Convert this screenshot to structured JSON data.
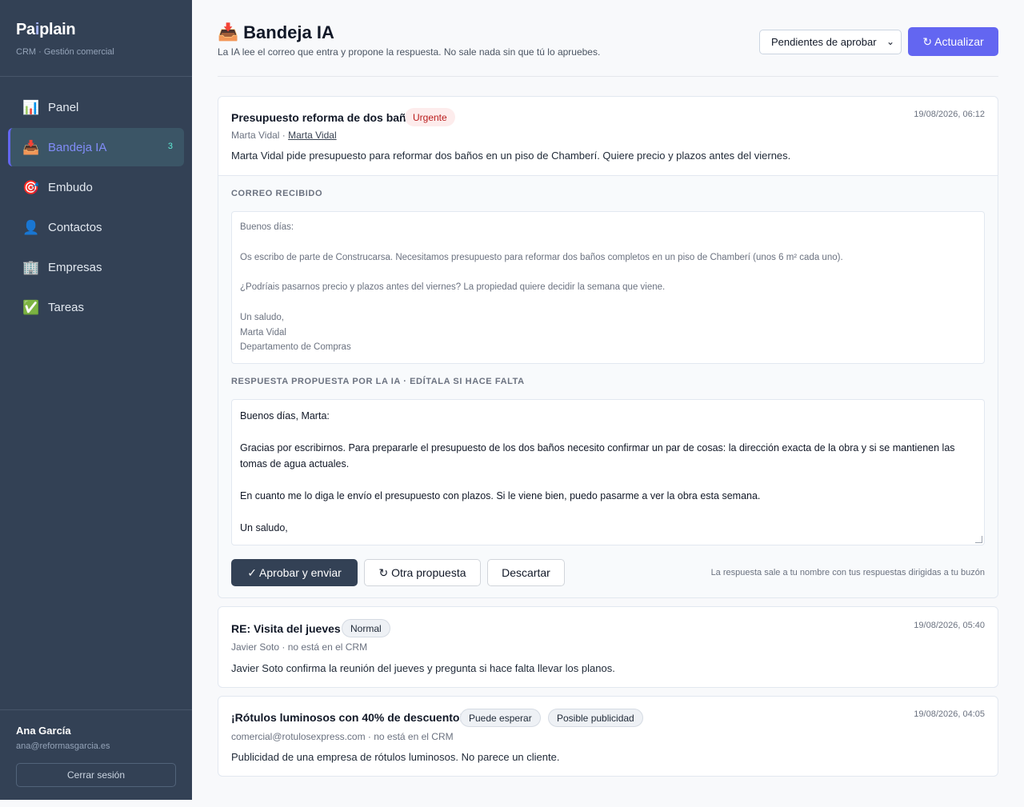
{
  "sidebar": {
    "brand_prefix": "Pa",
    "brand_accent": "i",
    "brand_suffix": "plain",
    "subtitle": "CRM · Gestión comercial",
    "items": [
      {
        "label": "Panel",
        "icon": "📊"
      },
      {
        "label": "Bandeja IA",
        "icon": "📥",
        "badge": "3"
      },
      {
        "label": "Embudo",
        "icon": "🎯"
      },
      {
        "label": "Contactos",
        "icon": "👤"
      },
      {
        "label": "Empresas",
        "icon": "🏢"
      },
      {
        "label": "Tareas",
        "icon": "✅"
      }
    ],
    "user_name": "Ana García",
    "user_email": "ana@reformasgarcia.es",
    "logout_label": "Cerrar sesión"
  },
  "header": {
    "icon": "📥",
    "title": "Bandeja IA",
    "subtitle": "La IA lee el correo que entra y propone la respuesta. No sale nada sin que tú lo apruebes.",
    "filter_value": "Pendientes de aprobar",
    "refresh_label": "↻ Actualizar"
  },
  "messages": [
    {
      "title": "Presupuesto reforma de dos baños",
      "tag": "Urgente",
      "date": "19/08/2026, 06:12",
      "sender": "Marta Vidal · ",
      "sender_link": "Marta Vidal",
      "summary": "Marta Vidal pide presupuesto para reformar dos baños en un piso de Chamberí. Quiere precio y plazos antes del viernes.",
      "received_label": "CORREO RECIBIDO",
      "received_lines": [
        "Buenos días:",
        "",
        "Os escribo de parte de Construcarsa. Necesitamos presupuesto para reformar dos baños completos en un piso de Chamberí (unos 6 m² cada uno).",
        "",
        "¿Podríais pasarnos precio y plazos antes del viernes? La propiedad quiere decidir la semana que viene.",
        "",
        "Un saludo,",
        "Marta Vidal",
        "Departamento de Compras"
      ],
      "reply_label": "RESPUESTA PROPUESTA POR LA IA · EDÍTALA SI HACE FALTA",
      "reply_lines": [
        "Buenos días, Marta:",
        "",
        "Gracias por escribirnos. Para prepararle el presupuesto de los dos baños necesito confirmar un par de cosas: la dirección exacta de la obra y si se mantienen las tomas de agua actuales.",
        "",
        "En cuanto me lo diga le envío el presupuesto con plazos. Si le viene bien, puedo pasarme a ver la obra esta semana.",
        "",
        "Un saludo,"
      ],
      "approve_label": "✓ Aprobar y enviar",
      "regenerate_label": "↻ Otra propuesta",
      "discard_label": "Descartar",
      "note": "La respuesta sale a tu nombre con tus respuestas dirigidas a tu buzón"
    },
    {
      "title": "RE: Visita del jueves",
      "tag": "Normal",
      "date": "19/08/2026, 05:40",
      "sender": "Javier Soto · no está en el CRM",
      "summary": "Javier Soto confirma la reunión del jueves y pregunta si hace falta llevar los planos."
    },
    {
      "title": "¡Rótulos luminosos con 40% de descuento!",
      "tags": [
        "Puede esperar",
        "Posible publicidad"
      ],
      "date": "19/08/2026, 04:05",
      "sender": "comercial@rotulosexpress.com · no está en el CRM",
      "summary": "Publicidad de una empresa de rótulos luminosos. No parece un cliente."
    }
  ],
  "colors": {
    "sidebar_bg": "#334155",
    "accent": "#6366f1",
    "urgent_bg": "#fdecec",
    "urgent_text": "#b91c1c"
  }
}
